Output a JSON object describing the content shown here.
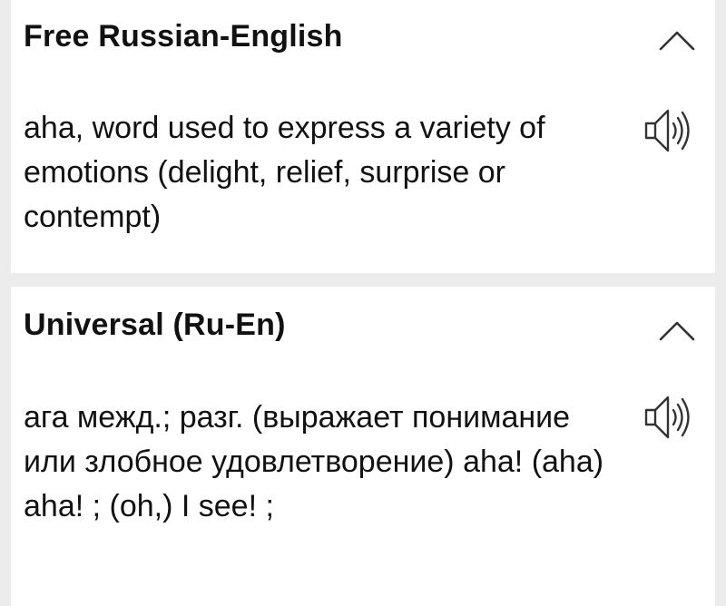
{
  "entries": [
    {
      "dictionary": "Free Russian-English",
      "definition": "aha, word used to express a variety of emotions (delight, relief, surprise or contempt)",
      "collapse_icon": "chevron-up-icon",
      "audio_icon": "speaker-icon"
    },
    {
      "dictionary": "Universal (Ru-En)",
      "definition": "ага межд.; разг. (выражает понимание или злобное удовлетворение) aha! (aha) aha! ; (oh,) I see! ;",
      "collapse_icon": "chevron-up-icon",
      "audio_icon": "speaker-icon"
    }
  ],
  "colors": {
    "background": "#ececec",
    "card": "#ffffff",
    "text": "#111111",
    "icon": "#333333"
  }
}
